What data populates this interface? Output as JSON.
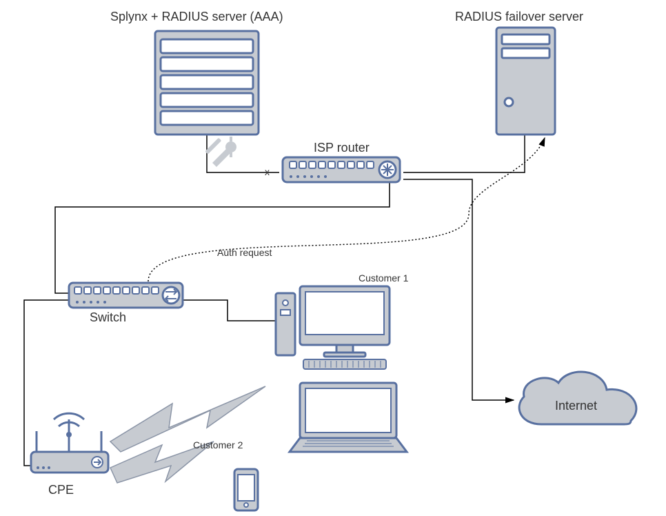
{
  "labels": {
    "splynx_title": "Splynx + RADIUS server (AAA)",
    "failover_title": "RADIUS failover server",
    "isp_router": "ISP router",
    "auth_request": "Auth request",
    "switch": "Switch",
    "customer1": "Customer 1",
    "customer2": "Customer 2",
    "cpe": "CPE",
    "internet": "Internet",
    "x_mark": "x"
  },
  "nodes": [
    {
      "id": "splynx",
      "type": "server-rack",
      "label": "Splynx + RADIUS server (AAA)"
    },
    {
      "id": "failover",
      "type": "server-tower",
      "label": "RADIUS failover server"
    },
    {
      "id": "isp-router",
      "type": "router",
      "label": "ISP router"
    },
    {
      "id": "switch",
      "type": "switch",
      "label": "Switch"
    },
    {
      "id": "cpe",
      "type": "cpe",
      "label": "CPE"
    },
    {
      "id": "customer1",
      "type": "desktop",
      "label": "Customer 1"
    },
    {
      "id": "customer2-laptop",
      "type": "laptop",
      "label": "Customer 2"
    },
    {
      "id": "customer2-phone",
      "type": "phone",
      "label": "Customer 2"
    },
    {
      "id": "internet",
      "type": "cloud",
      "label": "Internet"
    }
  ],
  "edges": [
    {
      "from": "splynx",
      "to": "isp-router",
      "style": "solid",
      "note": "broken (x)"
    },
    {
      "from": "isp-router",
      "to": "failover",
      "style": "solid"
    },
    {
      "from": "isp-router",
      "to": "switch",
      "style": "solid"
    },
    {
      "from": "isp-router",
      "to": "internet",
      "style": "solid",
      "arrow": true
    },
    {
      "from": "switch",
      "to": "customer1",
      "style": "solid"
    },
    {
      "from": "switch",
      "to": "cpe",
      "style": "solid"
    },
    {
      "from": "switch",
      "to": "failover",
      "style": "dotted",
      "label": "Auth request",
      "arrow": true
    },
    {
      "from": "cpe",
      "to": "customer2-laptop",
      "style": "wireless"
    },
    {
      "from": "cpe",
      "to": "customer2-phone",
      "style": "wireless"
    }
  ]
}
